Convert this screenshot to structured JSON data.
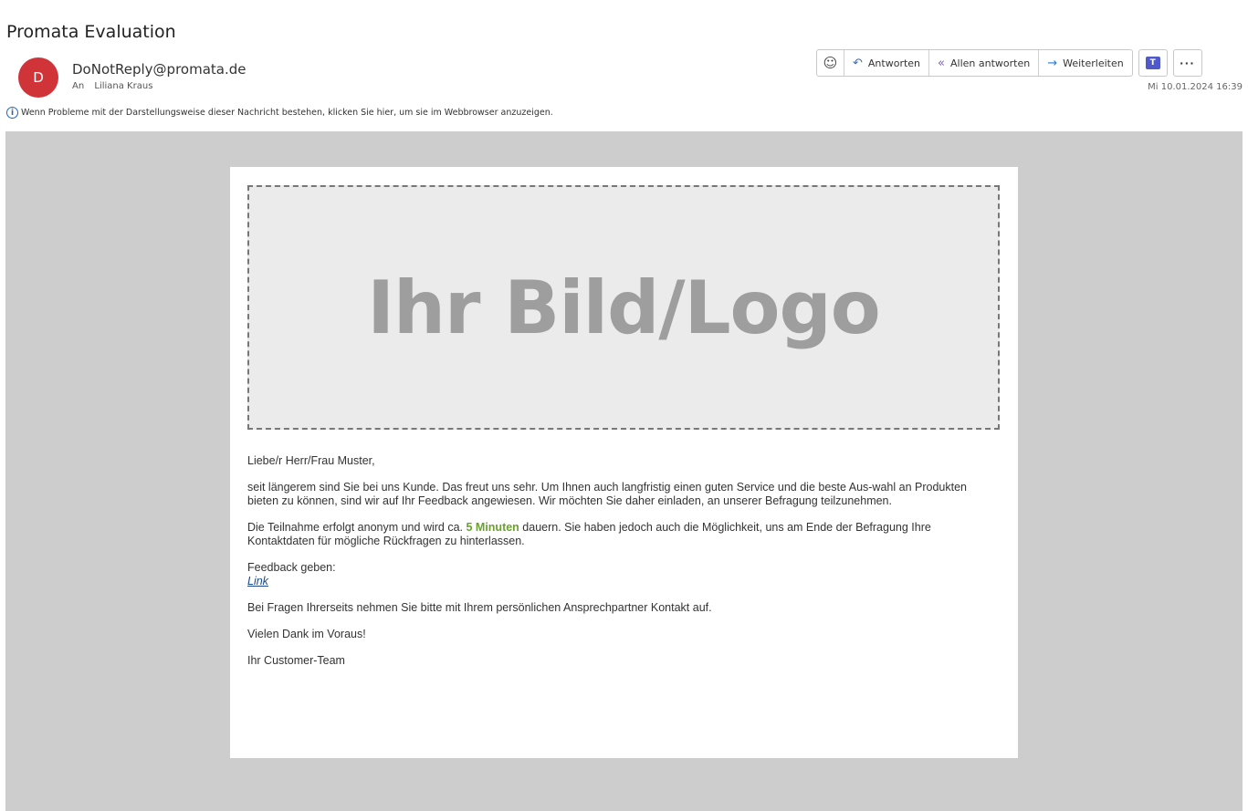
{
  "header": {
    "subject": "Promata Evaluation",
    "avatar_initial": "D",
    "sender": "DoNotReply@promata.de",
    "to_label": "An",
    "recipient": "Liliana Kraus",
    "info_text": "Wenn Probleme mit der Darstellungsweise dieser Nachricht bestehen, klicken Sie hier, um sie im Webbrowser anzuzeigen.",
    "date": "Mi 10.01.2024 16:39"
  },
  "toolbar": {
    "emoji_icon": "smiley-icon",
    "reply_label": "Antworten",
    "reply_all_label": "Allen antworten",
    "forward_label": "Weiterleiten",
    "teams_icon": "teams-icon",
    "more_icon": "more-icon"
  },
  "mail": {
    "logo_placeholder": "Ihr Bild/Logo",
    "greeting": "Liebe/r Herr/Frau Muster,",
    "paragraph1": "seit längerem sind Sie bei uns Kunde. Das freut uns sehr. Um Ihnen auch langfristig einen guten Service und die beste Aus-wahl an Produkten bieten zu können, sind wir auf Ihr Feedback angewiesen. Wir möchten Sie daher einladen, an unserer Befragung teilzunehmen.",
    "paragraph2_before": "Die Teilnahme erfolgt anonym und wird ca. ",
    "paragraph2_highlight": "5 Minuten",
    "paragraph2_after": " dauern. Sie haben jedoch auch die Möglichkeit, uns am Ende der Befragung Ihre Kontaktdaten für mögliche Rückfragen zu hinterlassen.",
    "feedback_label": "Feedback geben:",
    "link_text": "Link",
    "questions": "Bei Fragen Ihrerseits nehmen Sie bitte mit Ihrem persönlichen Ansprechpartner Kontakt auf.",
    "thanks": "Vielen Dank im Voraus!",
    "signature": "Ihr Customer-Team"
  },
  "colors": {
    "avatar": "#d13438",
    "highlight": "#6aa12f",
    "link": "#1a4a8a",
    "mail_background": "#cdcdcd"
  }
}
